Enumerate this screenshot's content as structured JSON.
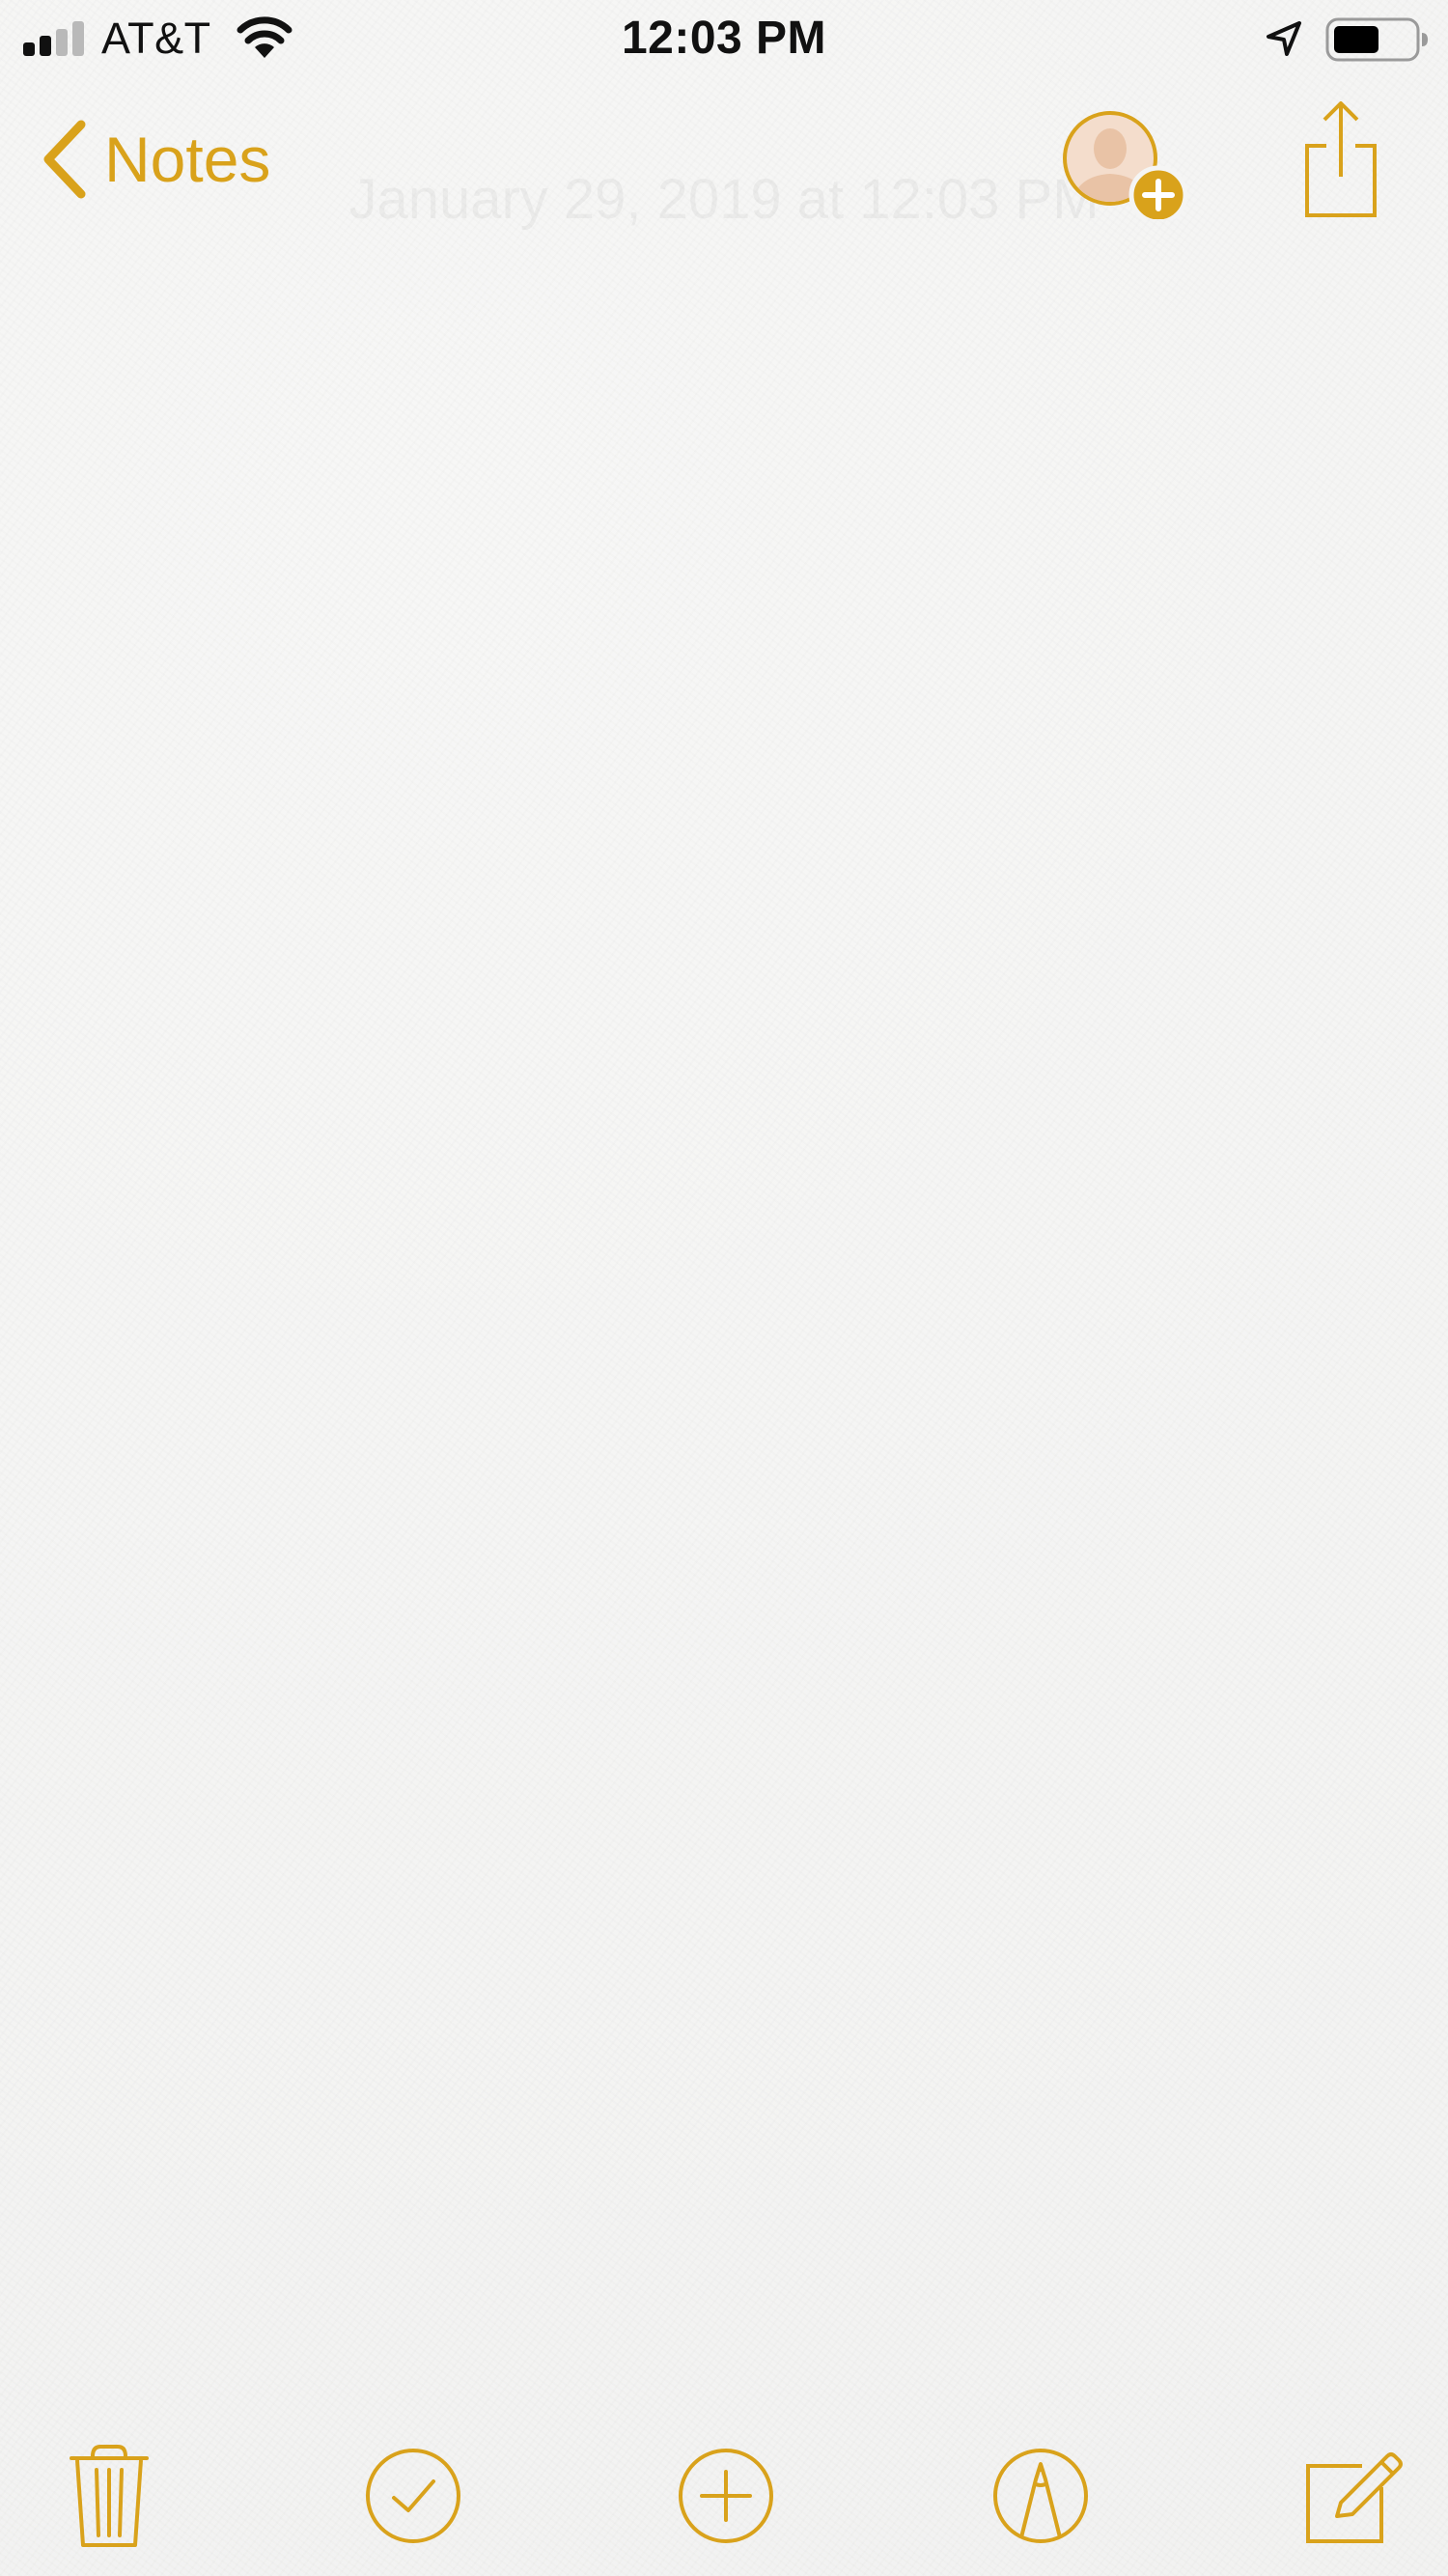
{
  "status_bar": {
    "carrier": "AT&T",
    "time": "12:03 PM"
  },
  "nav": {
    "back_label": "Notes",
    "note_title_ghost": "January 29, 2019 at 12:03 PM"
  },
  "colors": {
    "accent": "#d9a21b",
    "text": "#111111",
    "background": "#f5f5f4"
  },
  "icons": {
    "back": "chevron-left-icon",
    "add_people": "add-person-icon",
    "share": "share-icon",
    "delete": "trash-icon",
    "checklist": "checkmark-circle-icon",
    "add": "plus-circle-icon",
    "markup": "markup-pen-icon",
    "compose": "compose-icon"
  }
}
